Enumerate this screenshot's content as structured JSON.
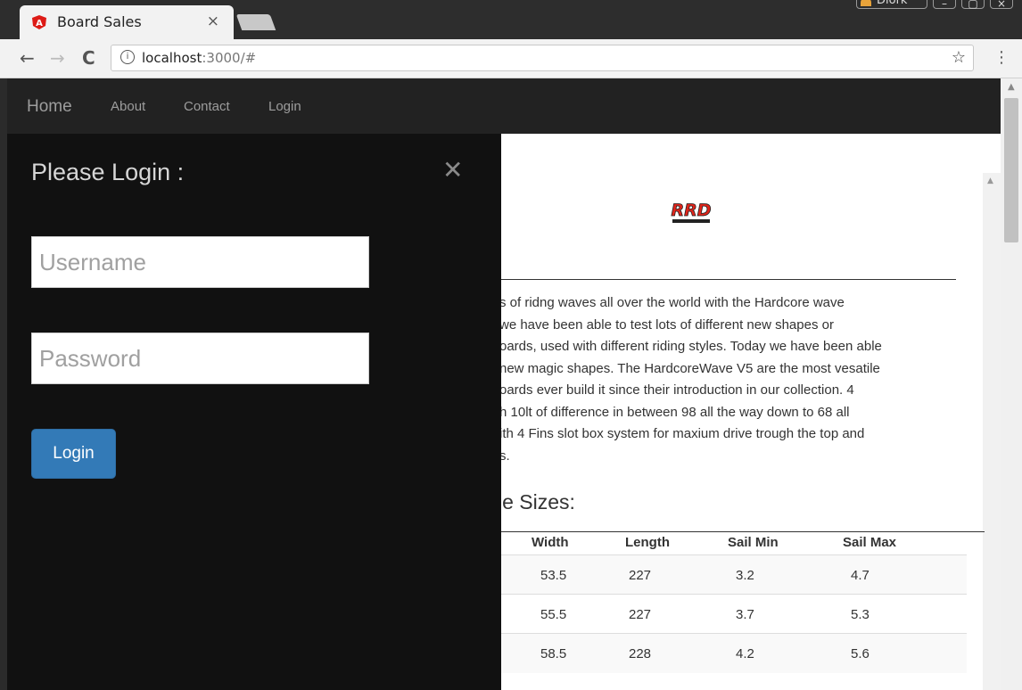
{
  "browser": {
    "tab_title": "Board Sales",
    "tab_close": "×",
    "url_host": "localhost",
    "url_rest": ":3000/#",
    "user_label": "Dlork",
    "back": "←",
    "forward": "→",
    "reload": "C",
    "star": "☆",
    "menu": "⋮",
    "info": "i"
  },
  "navbar": {
    "brand": "Home",
    "items": [
      "About",
      "Contact",
      "Login"
    ]
  },
  "login": {
    "title": "Please Login :",
    "close": "✕",
    "username_placeholder": "Username",
    "password_placeholder": "Password",
    "button": "Login"
  },
  "content": {
    "description_lines": [
      "s of ridng waves all over the world with the Hardcore wave",
      "we have been able to test lots of different new shapes or",
      "oards, used with different riding styles. Today we have been able",
      " new magic shapes. The HardcoreWave V5 are the most vesatile",
      "oards ever build it since their introduction in our collection. 4",
      "h 10lt of difference in between 98 all the way down to 68 all",
      "ith 4 Fins slot box system for maxium drive trough the top and",
      "s."
    ],
    "sizes_title": "le Sizes:",
    "table": {
      "headers": [
        "Width",
        "Length",
        "Sail Min",
        "Sail Max"
      ],
      "rows": [
        [
          "53.5",
          "227",
          "3.2",
          "4.7"
        ],
        [
          "55.5",
          "227",
          "3.7",
          "5.3"
        ],
        [
          "58.5",
          "228",
          "4.2",
          "5.6"
        ]
      ]
    }
  },
  "colors": {
    "navbar_bg": "#222222",
    "panel_bg": "#111111",
    "primary_button": "#337ab7",
    "logo_red": "#e1251b"
  }
}
